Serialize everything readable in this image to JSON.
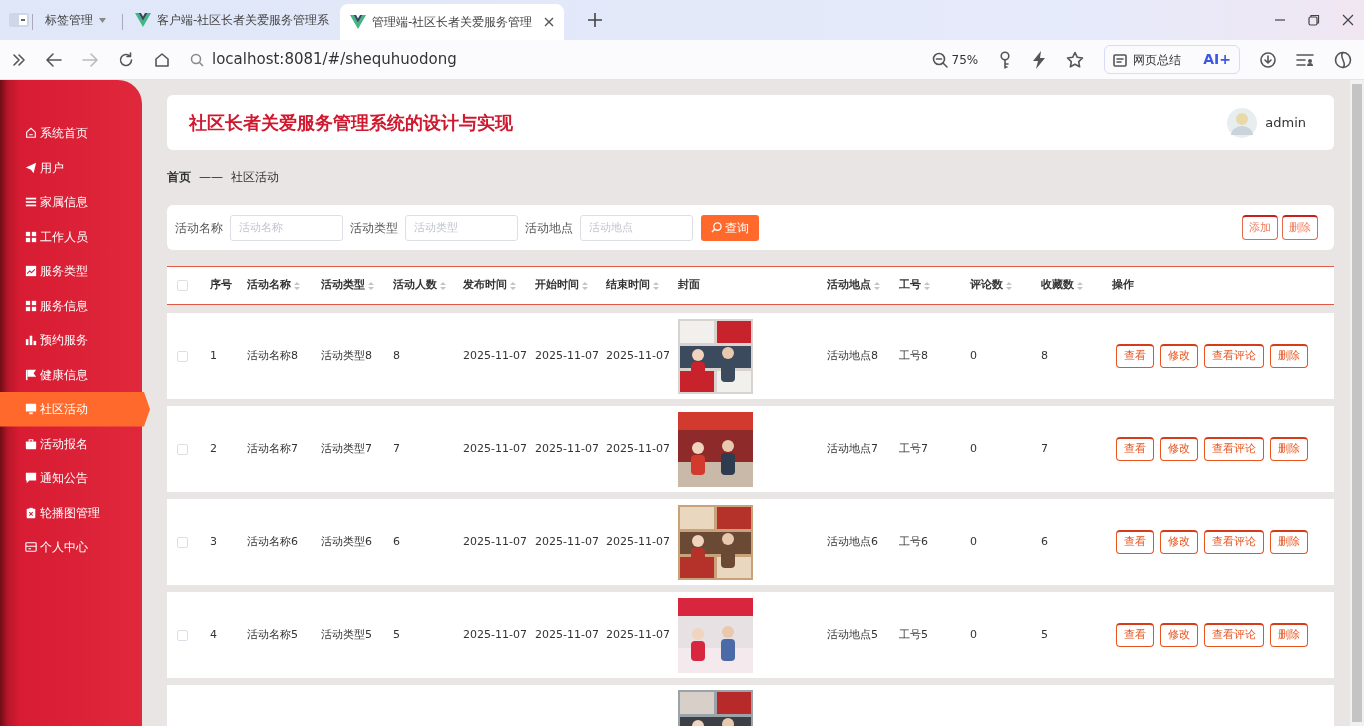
{
  "browser": {
    "tabs": [
      {
        "label": "标签管理",
        "kind": "group",
        "selected": false
      },
      {
        "label": "客户端-社区长者关爱服务管理系",
        "kind": "page",
        "selected": false
      },
      {
        "label": "管理端-社区长者关爱服务管理",
        "kind": "page",
        "selected": true
      }
    ],
    "url": "localhost:8081/#/shequhuodong",
    "zoom": "75%",
    "summary_button": "网页总结",
    "ai_button": "AI+"
  },
  "sidebar": {
    "items": [
      {
        "label": "系统首页",
        "selected": false
      },
      {
        "label": "用户",
        "selected": false
      },
      {
        "label": "家属信息",
        "selected": false
      },
      {
        "label": "工作人员",
        "selected": false
      },
      {
        "label": "服务类型",
        "selected": false
      },
      {
        "label": "服务信息",
        "selected": false
      },
      {
        "label": "预约服务",
        "selected": false
      },
      {
        "label": "健康信息",
        "selected": false
      },
      {
        "label": "社区活动",
        "selected": true
      },
      {
        "label": "活动报名",
        "selected": false
      },
      {
        "label": "通知公告",
        "selected": false
      },
      {
        "label": "轮播图管理",
        "selected": false
      },
      {
        "label": "个人中心",
        "selected": false
      }
    ]
  },
  "header": {
    "title": "社区长者关爱服务管理系统的设计与实现",
    "user": "admin"
  },
  "breadcrumb": {
    "items": [
      "首页",
      "社区活动"
    ],
    "separator": "——"
  },
  "search": {
    "fields": [
      {
        "label": "活动名称",
        "placeholder": "活动名称"
      },
      {
        "label": "活动类型",
        "placeholder": "活动类型"
      },
      {
        "label": "活动地点",
        "placeholder": "活动地点"
      }
    ],
    "button": "查询"
  },
  "actions": [
    "添加",
    "删除"
  ],
  "table": {
    "select_all": {
      "checked": false
    },
    "columns": [
      {
        "label": "序号",
        "kind": "text",
        "sortable": false
      },
      {
        "label": "活动名称",
        "kind": "text",
        "sortable": true
      },
      {
        "label": "活动类型",
        "kind": "text",
        "sortable": true
      },
      {
        "label": "活动人数",
        "kind": "text",
        "sortable": true
      },
      {
        "label": "发布时间",
        "kind": "text",
        "sortable": true
      },
      {
        "label": "开始时间",
        "kind": "text",
        "sortable": true
      },
      {
        "label": "结束时间",
        "kind": "text",
        "sortable": true
      },
      {
        "label": "封面",
        "sortable": false
      },
      {
        "label": "活动地点",
        "kind": "text",
        "sortable": true
      },
      {
        "label": "工号",
        "kind": "text",
        "sortable": true
      },
      {
        "label": "评论数",
        "kind": "text",
        "sortable": true
      },
      {
        "label": "收藏数",
        "kind": "text",
        "sortable": true
      },
      {
        "label": "操作",
        "kind": "actions",
        "sortable": false
      }
    ],
    "rows": [
      {
        "checked": false,
        "cells": [
          "1",
          "活动名称8",
          "活动类型8",
          "8",
          "2025-11-07",
          "2025-11-07",
          "2025-11-07",
          {
            "kind": "picture"
          },
          "活动地点8",
          "工号8",
          "0",
          "8"
        ],
        "actions": [
          "查看",
          "修改",
          "查看评论",
          "删除"
        ]
      },
      {
        "checked": false,
        "cells": [
          "2",
          "活动名称7",
          "活动类型7",
          "7",
          "2025-11-07",
          "2025-11-07",
          "2025-11-07",
          {
            "kind": "picture"
          },
          "活动地点7",
          "工号7",
          "0",
          "7"
        ],
        "actions": [
          "查看",
          "修改",
          "查看评论",
          "删除"
        ]
      },
      {
        "checked": false,
        "cells": [
          "3",
          "活动名称6",
          "活动类型6",
          "6",
          "2025-11-07",
          "2025-11-07",
          "2025-11-07",
          {
            "kind": "picture"
          },
          "活动地点6",
          "工号6",
          "0",
          "6"
        ],
        "actions": [
          "查看",
          "修改",
          "查看评论",
          "删除"
        ]
      },
      {
        "checked": false,
        "cells": [
          "4",
          "活动名称5",
          "活动类型5",
          "5",
          "2025-11-07",
          "2025-11-07",
          "2025-11-07",
          {
            "kind": "picture"
          },
          "活动地点5",
          "工号5",
          "0",
          "5"
        ],
        "actions": [
          "查看",
          "修改",
          "查看评论",
          "删除"
        ]
      }
    ],
    "cut_row": {
      "cover": {
        "kind": "picture"
      }
    }
  }
}
